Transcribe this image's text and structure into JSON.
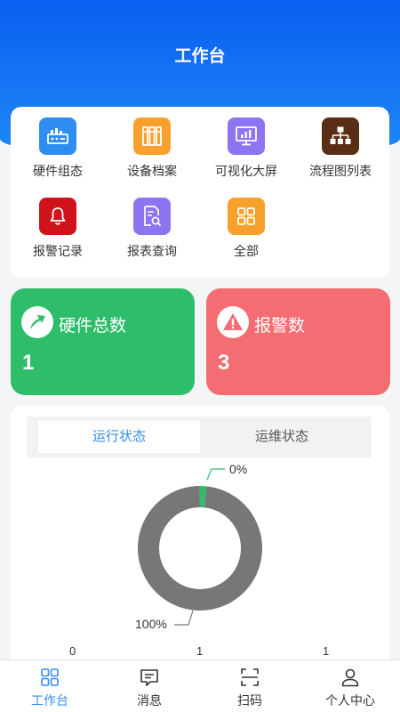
{
  "header": {
    "title": "工作台"
  },
  "menu": {
    "items": [
      {
        "label": "硬件组态",
        "icon": "hardware-config-icon",
        "color": "#2f8cf0"
      },
      {
        "label": "设备档案",
        "icon": "device-archive-icon",
        "color": "#f7a02c"
      },
      {
        "label": "可视化大屏",
        "icon": "visualization-screen-icon",
        "color": "#8e74f0"
      },
      {
        "label": "流程图列表",
        "icon": "flowchart-icon",
        "color": "#5a2e15"
      },
      {
        "label": "报警记录",
        "icon": "alarm-bell-icon",
        "color": "#d0121b"
      },
      {
        "label": "报表查询",
        "icon": "report-search-icon",
        "color": "#8e74f0"
      },
      {
        "label": "全部",
        "icon": "grid-all-icon",
        "color": "#f7a02c"
      }
    ]
  },
  "stats": {
    "hardware": {
      "title": "硬件总数",
      "value": "1",
      "color": "#2ebd6b",
      "icon": "trend-up-icon"
    },
    "alarm": {
      "title": "报警数",
      "value": "3",
      "color": "#f46d72",
      "icon": "warning-icon"
    }
  },
  "status": {
    "tabs": [
      {
        "label": "运行状态",
        "active": true
      },
      {
        "label": "运维状态",
        "active": false
      }
    ]
  },
  "chart_data": {
    "type": "pie",
    "values": [
      0,
      100
    ],
    "data_labels": [
      "0%",
      "100%"
    ],
    "colors": [
      "#2ebd6b",
      "#777777"
    ],
    "axis_ticks": [
      "0",
      "1",
      "1"
    ]
  },
  "tabbar": {
    "items": [
      {
        "label": "工作台",
        "icon": "workbench-icon",
        "active": true
      },
      {
        "label": "消息",
        "icon": "message-icon",
        "active": false
      },
      {
        "label": "扫码",
        "icon": "scan-icon",
        "active": false
      },
      {
        "label": "个人中心",
        "icon": "user-icon",
        "active": false
      }
    ],
    "active_color": "#2f8cf0"
  }
}
